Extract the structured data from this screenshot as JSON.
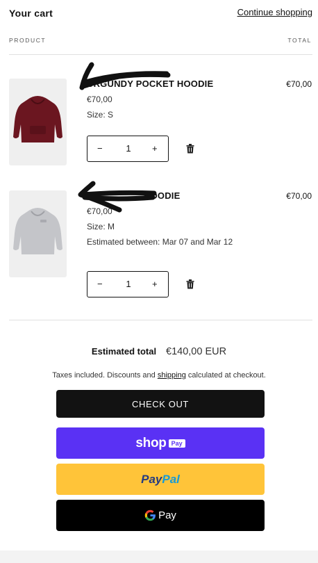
{
  "header": {
    "title": "Your cart",
    "continue_label": "Continue shopping"
  },
  "columns": {
    "product": "PRODUCT",
    "total": "TOTAL"
  },
  "items": [
    {
      "name": "BURGUNDY POCKET HOODIE",
      "visible_name": "URGUNDY POCKET HOODIE",
      "price": "€70,00",
      "size": "Size: S",
      "estimate": "",
      "quantity": "1",
      "line_total": "€70,00",
      "image_color": "#6b1620"
    },
    {
      "name": "GREY HOODIE",
      "visible_name": "HOODIE",
      "price": "€70,00",
      "size": "Size: M",
      "estimate": "Estimated between: Mar 07 and Mar 12",
      "quantity": "1",
      "line_total": "€70,00",
      "image_color": "#c4c5c9"
    }
  ],
  "qty_controls": {
    "minus": "−",
    "plus": "+"
  },
  "summary": {
    "estimated_label": "Estimated total",
    "estimated_value": "€140,00 EUR",
    "taxes_before": "Taxes included. Discounts and ",
    "taxes_link": "shipping",
    "taxes_after": " calculated at checkout."
  },
  "buttons": {
    "checkout": "CHECK OUT",
    "shoppay_word": "shop",
    "shoppay_badge": "Pay",
    "paypal_a": "Pay",
    "paypal_b": "Pal",
    "gpay_g": "G",
    "gpay_word": "Pay"
  },
  "colors": {
    "checkout_bg": "#121212",
    "shoppay_bg": "#5a31f4",
    "paypal_bg": "#ffc439",
    "gpay_bg": "#000000"
  }
}
